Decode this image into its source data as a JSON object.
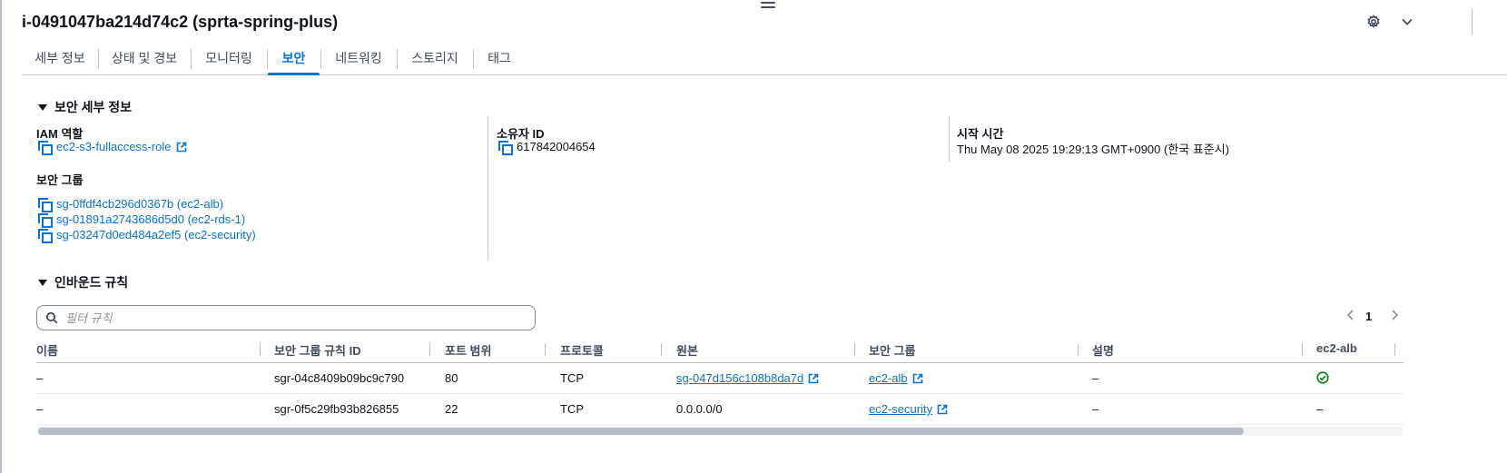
{
  "instance": {
    "title": "i-0491047ba214d74c2 (sprta-spring-plus)"
  },
  "tabs": [
    {
      "label": "세부 정보"
    },
    {
      "label": "상태 및 경보"
    },
    {
      "label": "모니터링"
    },
    {
      "label": "보안",
      "active": true
    },
    {
      "label": "네트워킹"
    },
    {
      "label": "스토리지"
    },
    {
      "label": "태그"
    }
  ],
  "security_details": {
    "heading": "보안 세부 정보",
    "iam_role_label": "IAM 역할",
    "iam_role_value": "ec2-s3-fullaccess-role",
    "security_groups_label": "보안 그룹",
    "security_groups": [
      "sg-0ffdf4cb296d0367b (ec2-alb)",
      "sg-01891a2743686d5d0 (ec2-rds-1)",
      "sg-03247d0ed484a2ef5 (ec2-security)"
    ],
    "owner_id_label": "소유자 ID",
    "owner_id_value": "617842004654",
    "launch_time_label": "시작 시간",
    "launch_time_value": "Thu May 08 2025 19:29:13 GMT+0900 (한국 표준시)"
  },
  "inbound_rules": {
    "heading": "인바운드 규칙",
    "filter_placeholder": "필터 규칙",
    "page": "1",
    "columns": [
      "이름",
      "보안 그룹 규칙 ID",
      "포트 범위",
      "프로토콜",
      "원본",
      "보안 그룹",
      "설명",
      "ec2-alb"
    ],
    "rows": [
      {
        "name": "–",
        "rule_id": "sgr-04c8409b09bc9c790",
        "port": "80",
        "protocol": "TCP",
        "source": "sg-047d156c108b8da7d",
        "source_is_link": true,
        "security_group": "ec2-alb",
        "description": "–",
        "ec2_alb": "check"
      },
      {
        "name": "–",
        "rule_id": "sgr-0f5c29fb93b826855",
        "port": "22",
        "protocol": "TCP",
        "source": "0.0.0.0/0",
        "source_is_link": false,
        "security_group": "ec2-security",
        "description": "–",
        "ec2_alb": "–"
      }
    ]
  },
  "colors": {
    "link": "#0972d3",
    "success": "#037f0c",
    "text": "#0f141a"
  },
  "icons": {
    "settings": "gear-icon",
    "collapse": "chevron-down-icon",
    "copy": "copy-icon",
    "external": "external-link-icon",
    "status": "check-circle-icon",
    "search": "search-icon"
  }
}
